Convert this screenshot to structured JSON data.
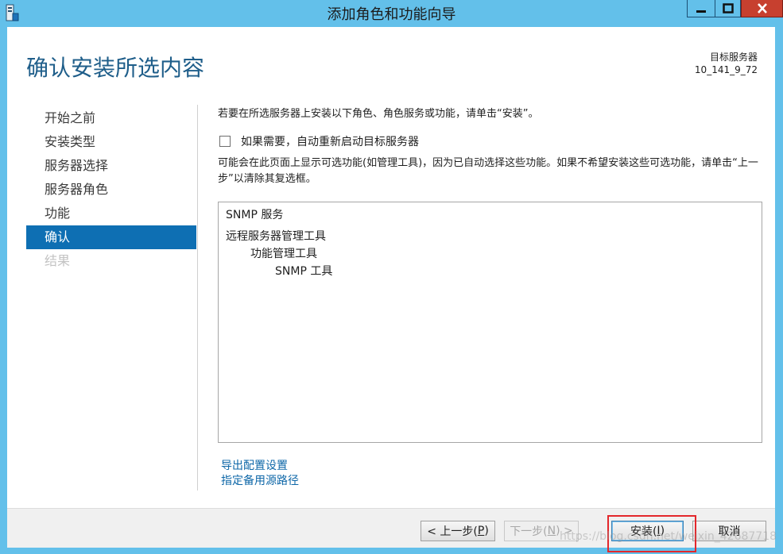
{
  "window": {
    "title": "添加角色和功能向导",
    "controls": {
      "minimize": "minimize",
      "maximize": "maximize",
      "close": "close"
    }
  },
  "header": {
    "title": "确认安装所选内容",
    "target_label": "目标服务器",
    "target_value": "10_141_9_72"
  },
  "nav": {
    "items": [
      {
        "label": "开始之前",
        "state": "normal"
      },
      {
        "label": "安装类型",
        "state": "normal"
      },
      {
        "label": "服务器选择",
        "state": "normal"
      },
      {
        "label": "服务器角色",
        "state": "normal"
      },
      {
        "label": "功能",
        "state": "normal"
      },
      {
        "label": "确认",
        "state": "active"
      },
      {
        "label": "结果",
        "state": "disabled"
      }
    ]
  },
  "content": {
    "intro": "若要在所选服务器上安装以下角色、角色服务或功能，请单击“安装”。",
    "restart_checkbox": {
      "label": "如果需要，自动重新启动目标服务器",
      "checked": false
    },
    "note": "可能会在此页面上显示可选功能(如管理工具)，因为已自动选择这些功能。如果不希望安装这些可选功能，请单击“上一步”以清除其复选框。",
    "features": [
      {
        "label": "SNMP 服务",
        "level": 0
      },
      {
        "label": "远程服务器管理工具",
        "level": 0
      },
      {
        "label": "功能管理工具",
        "level": 1
      },
      {
        "label": "SNMP 工具",
        "level": 2
      }
    ],
    "links": {
      "export": "导出配置设置",
      "source": "指定备用源路径"
    }
  },
  "footer": {
    "prev": {
      "text": "< 上一步(",
      "key": "P",
      "end": ")"
    },
    "next": {
      "text": "下一步(",
      "key": "N",
      "end": ") >"
    },
    "install": {
      "text": "安装(",
      "key": "I",
      "end": ")"
    },
    "cancel": "取消",
    "watermark": "https://blog.csdn.net/weixin_42687718"
  },
  "colors": {
    "titlebar": "#63c0ea",
    "accent": "#0e6fb3",
    "title_text": "#1f5e8a",
    "highlight": "#e3272b"
  }
}
